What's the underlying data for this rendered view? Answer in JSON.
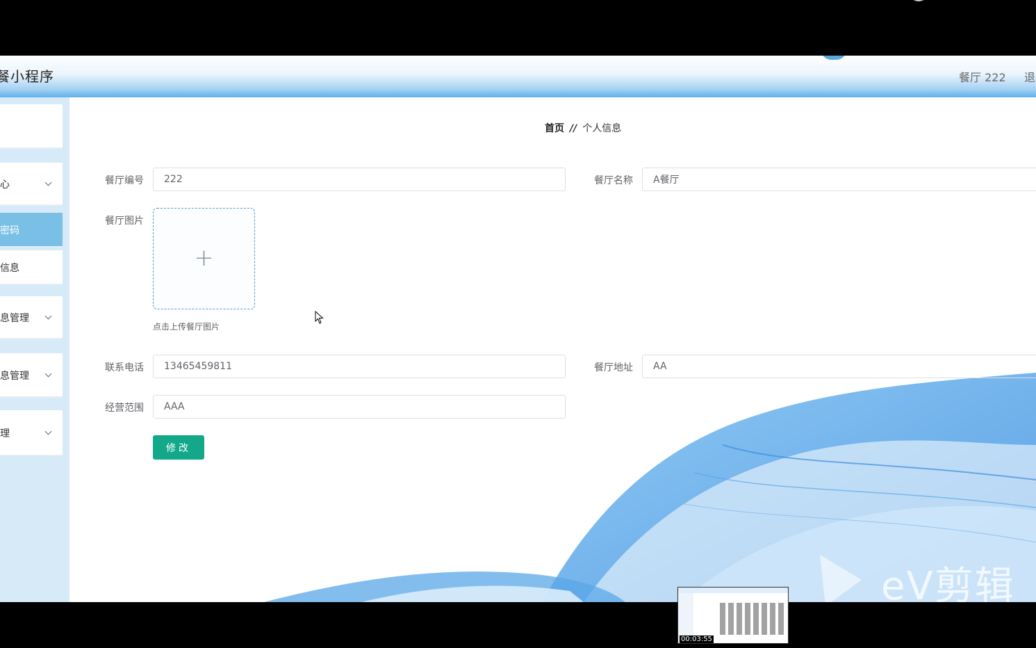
{
  "app": {
    "title": "餐小程序",
    "user_label": "餐厅 222",
    "logout_label": "退"
  },
  "sidebar": {
    "items": [
      {
        "label": "",
        "expandable": false,
        "active": false
      },
      {
        "label": "心",
        "expandable": true,
        "active": false
      },
      {
        "label": "密码",
        "expandable": false,
        "active": true
      },
      {
        "label": "信息",
        "expandable": false,
        "active": false
      },
      {
        "label": "息管理",
        "expandable": true,
        "active": false
      },
      {
        "label": "息管理",
        "expandable": true,
        "active": false
      },
      {
        "label": "理",
        "expandable": true,
        "active": false
      }
    ]
  },
  "breadcrumb": {
    "home": "首页",
    "separator": "//",
    "current": "个人信息"
  },
  "form": {
    "restaurant_no": {
      "label": "餐厅编号",
      "value": "222"
    },
    "restaurant_name": {
      "label": "餐厅名称",
      "value": "A餐厅"
    },
    "restaurant_image": {
      "label": "餐厅图片",
      "hint": "点击上传餐厅图片",
      "plus": "+"
    },
    "phone": {
      "label": "联系电话",
      "value": "13465459811"
    },
    "address": {
      "label": "餐厅地址",
      "value": "AA"
    },
    "scope": {
      "label": "经营范围",
      "value": "AAA"
    },
    "submit_label": "修改"
  },
  "overlay": {
    "watermark": "eV剪辑",
    "thumbnail_time": "00:03:55"
  },
  "colors": {
    "header_gradient_bottom": "#5fb0ea",
    "sidebar_bg": "#d6eaf8",
    "active_menu": "#79bfe6",
    "primary_button": "#13a88a",
    "wave": "#4a9ee6"
  }
}
